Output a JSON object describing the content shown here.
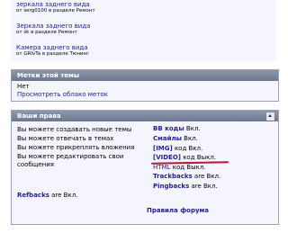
{
  "threads": [
    {
      "title": "зеркала заднего вида",
      "sub": "от serg0100 в разделе Ремонт"
    },
    {
      "title": "Зеркала заднего вида",
      "sub": "от sk в разделе Ремонт"
    },
    {
      "title": "Камера заднего вида",
      "sub": "от GRIvTa в разделе Тюнинг"
    }
  ],
  "tags_panel": {
    "title": "Метки этой темы",
    "none_text": "Нет",
    "cloud_link": "Просмотреть облако меток"
  },
  "rights_panel": {
    "title": "Ваши права",
    "left": [
      "Вы можете создавать новые темы",
      "Вы можете отвечать в темах",
      "Вы можете прикреплять вложения",
      "Вы можете редактировать свои",
      "сообщения"
    ],
    "codes": [
      {
        "link": "BB коды",
        "state": " Вкл."
      },
      {
        "link": "Смайлы",
        "state": " Вкл."
      },
      {
        "link": "[IMG]",
        "state": " код Вкл."
      },
      {
        "link": "[VIDEO]",
        "state": " код Выкл."
      },
      {
        "link": "HTML",
        "state": " код Выкл."
      },
      {
        "link": "Trackbacks",
        "state": " are Вкл."
      },
      {
        "link": "Pingbacks",
        "state": " are Вкл."
      }
    ],
    "refbacks_link": "Refbacks",
    "refbacks_state": " are Вкл.",
    "forum_rules_link": "Правила форума"
  },
  "colors": {
    "link": "#22229c",
    "panel_header": "#7a849a",
    "highlight_underline": "#c8102e"
  }
}
